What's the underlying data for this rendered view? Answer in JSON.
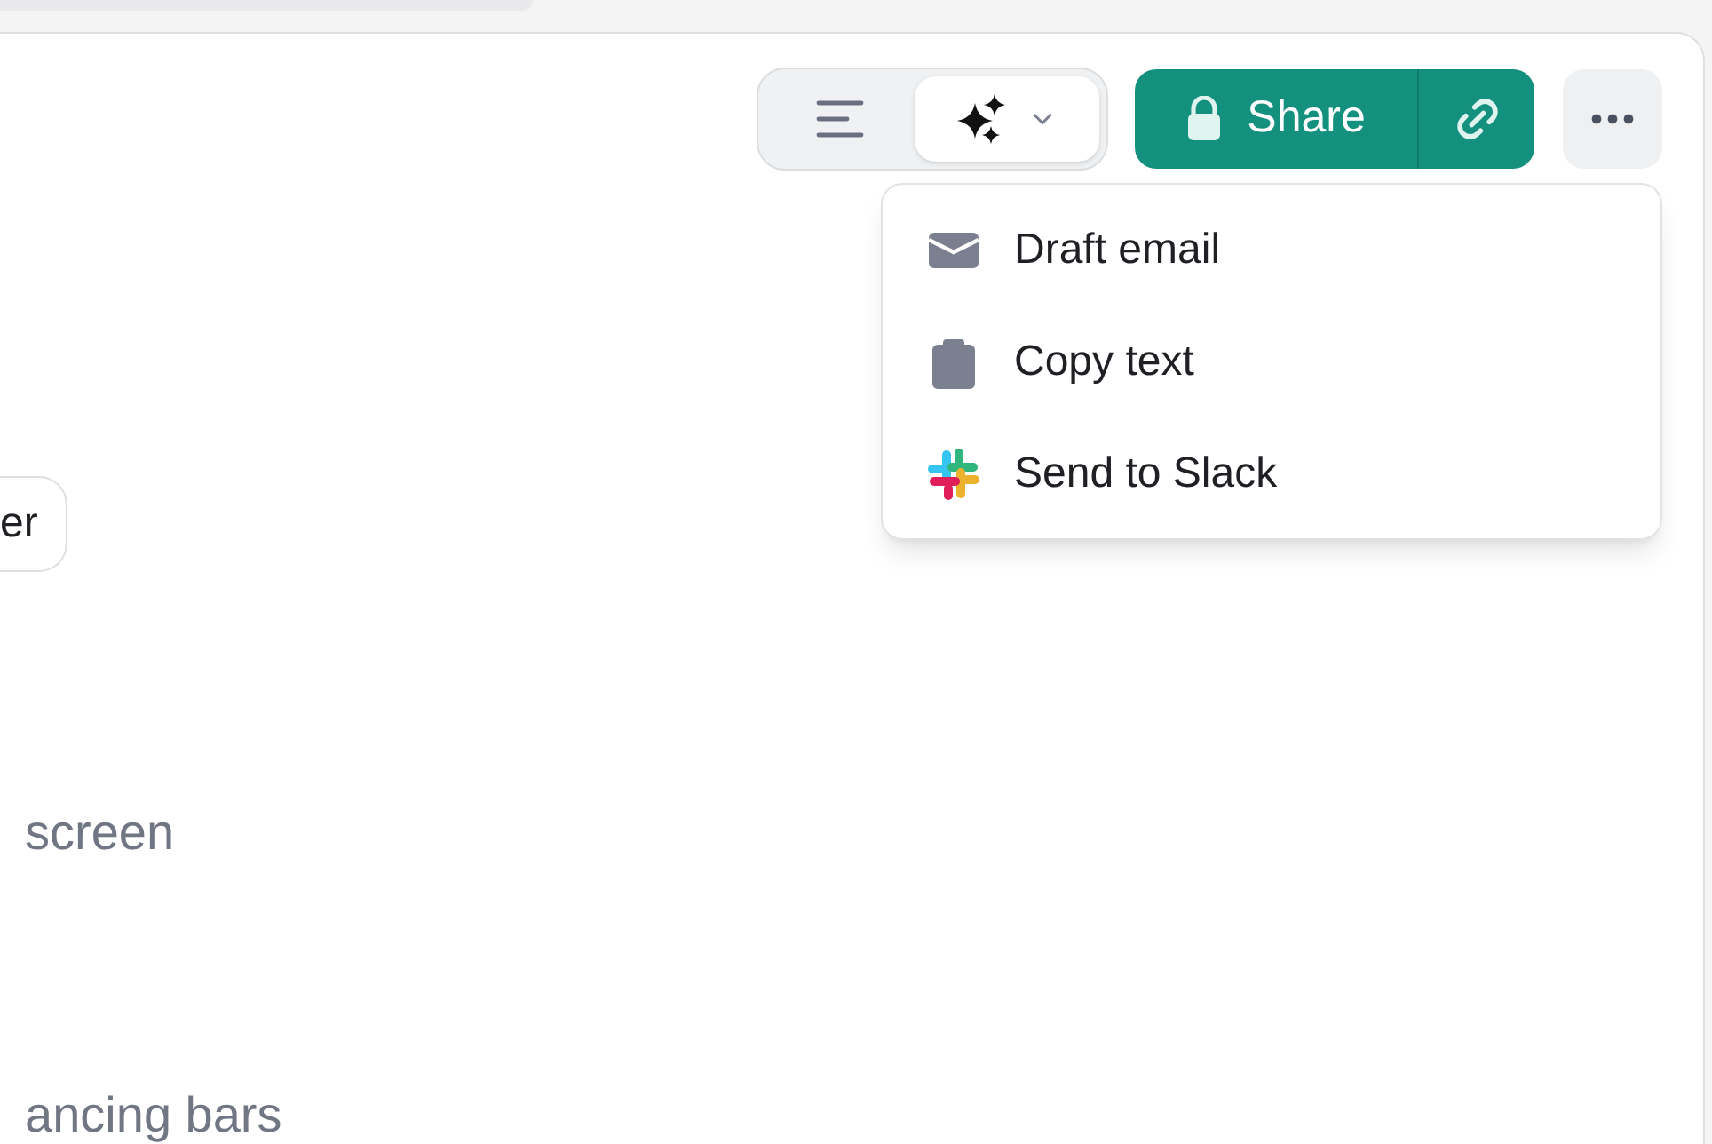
{
  "toolbar": {
    "view_toggle": [
      {
        "kind": "outline",
        "selected": false
      },
      {
        "kind": "ai",
        "selected": true
      }
    ],
    "share_button": {
      "label": "Share"
    }
  },
  "menu": {
    "items": [
      {
        "kind": "email",
        "label": "Draft email"
      },
      {
        "kind": "clipboard",
        "label": "Copy text"
      },
      {
        "kind": "slack",
        "label": "Send to Slack"
      }
    ]
  },
  "content": {
    "chip": "er",
    "lines": [
      "screen",
      "ancing bars"
    ]
  }
}
